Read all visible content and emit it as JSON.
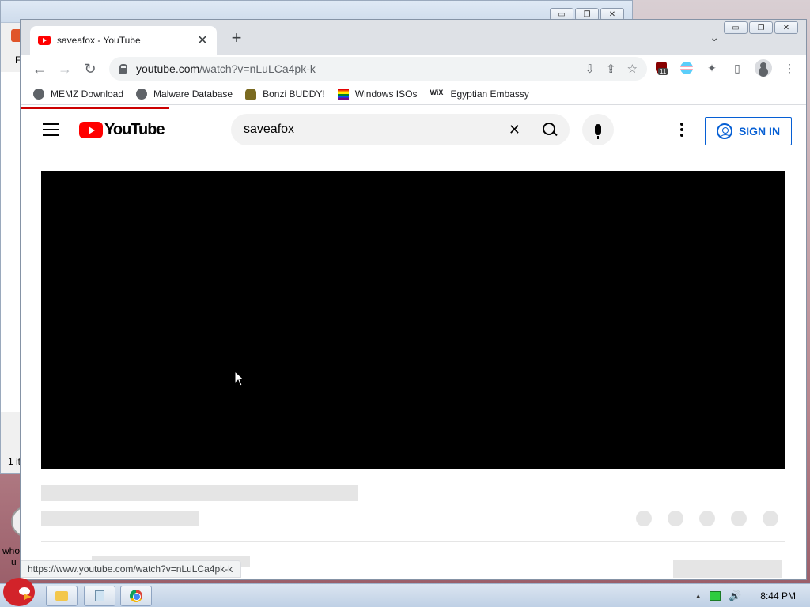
{
  "background_window": {
    "menu_fragment": "F",
    "status_fragment": "1 it",
    "side_text_1": "who",
    "side_text_2": "u"
  },
  "browser": {
    "tab": {
      "title": "saveafox - YouTube",
      "close_glyph": "✕"
    },
    "new_tab_glyph": "+",
    "tab_list_glyph": "⌄",
    "window_buttons": {
      "minimize": "▭",
      "restore": "❐",
      "close": "✕"
    },
    "nav": {
      "back": "←",
      "forward": "→",
      "reload": "↻"
    },
    "url_host": "youtube.com",
    "url_path": "/watch?v=nLuLCa4pk-k",
    "omnibox_icons": {
      "install": "⇩",
      "share": "⇪",
      "bookmark": "☆"
    },
    "extensions": {
      "badge_count": "11",
      "puzzle": "✦",
      "sidepanel": "▯",
      "menu": "⋮"
    },
    "bookmarks": [
      {
        "label": "MEMZ Download",
        "icon": "globe-icon"
      },
      {
        "label": "Malware Database",
        "icon": "globe-icon"
      },
      {
        "label": "Bonzi BUDDY!",
        "icon": "bonzi-icon"
      },
      {
        "label": "Windows ISOs",
        "icon": "windows-iso-icon"
      },
      {
        "label": "Egyptian Embassy",
        "icon": "wix-icon",
        "icon_text": "WiX"
      }
    ],
    "status_url": "https://www.youtube.com/watch?v=nLuLCa4pk-k",
    "accent_color": "#cc0000"
  },
  "youtube": {
    "logo_text": "YouTube",
    "search_value": "saveafox",
    "clear_glyph": "✕",
    "sign_in_label": "SIGN IN",
    "sign_in_color": "#065fd4"
  },
  "taskbar": {
    "clock": "8:44 PM",
    "tray_arrow": "▲",
    "volume_glyph": "🔊"
  }
}
